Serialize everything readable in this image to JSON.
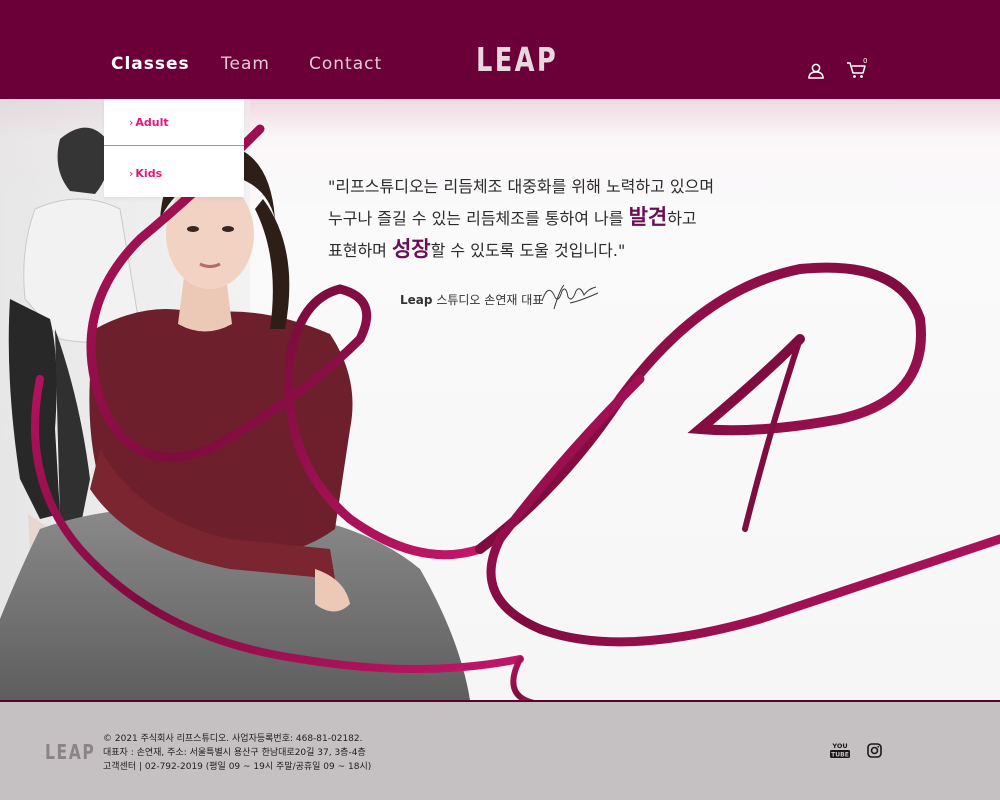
{
  "nav": {
    "items": [
      {
        "label": "Classes",
        "active": true
      },
      {
        "label": "Team",
        "active": false
      },
      {
        "label": "Contact",
        "active": false
      }
    ],
    "logo": "LEAP",
    "cart_count": "0"
  },
  "dropdown": {
    "items": [
      {
        "label": "Adult"
      },
      {
        "label": "Kids"
      }
    ]
  },
  "hero": {
    "quote_line1": "\"리프스튜디오는 리듬체조 대중화를 위해 노력하고 있으며",
    "quote_line2_pre": "누구나 즐길 수 있는 리듬체조를 통하여 나를 ",
    "quote_line2_hl": "발견",
    "quote_line2_post": "하고",
    "quote_line3_pre": "표현하며 ",
    "quote_line3_hl": "성장",
    "quote_line3_post": "할 수 있도록 도울 것입니다.\"",
    "author_brand": "Leap",
    "author_rest": "스튜디오 손연재 대표"
  },
  "footer": {
    "logo": "LEAP",
    "line1": "© 2021 주식회사 리프스튜디오. 사업자등록번호: 468-81-02182.",
    "line2": "대표자 : 손연재, 주소: 서울특별시 용산구 한남대로20길 37, 3층-4층",
    "line3": "고객센터 | 02-792-2019 (평일 09 ~ 19시 주말/공휴일 09 ~ 18시)"
  },
  "colors": {
    "brand": "#6a0037",
    "accent_pink": "#e2177a",
    "ribbon": "#9c1150",
    "footer_bg": "#c5c0c2"
  },
  "icons": [
    "user-icon",
    "cart-icon",
    "chevron-right-icon",
    "youtube-icon",
    "instagram-icon"
  ]
}
